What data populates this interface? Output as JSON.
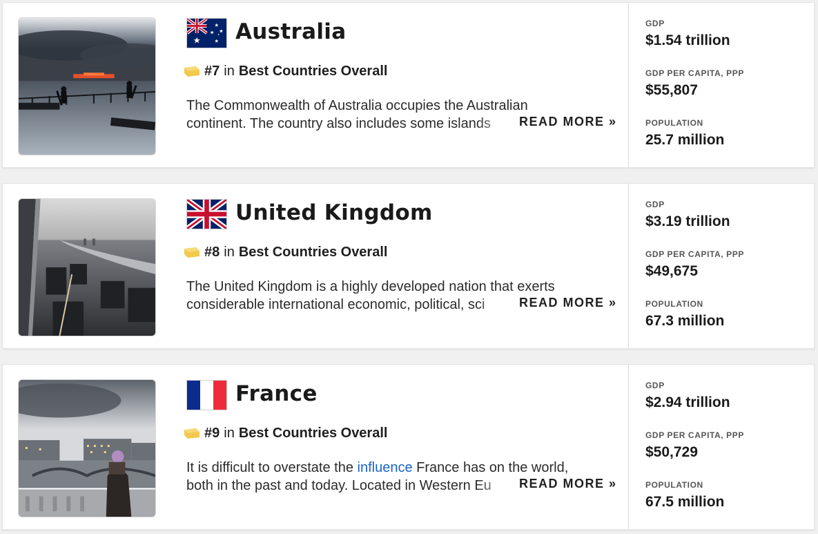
{
  "ranking_category": "Best Countries Overall",
  "rank_in": "in",
  "read_more": "READ MORE »",
  "stat_labels": {
    "gdp": "GDP",
    "gdp_per_capita": "GDP PER CAPITA, PPP",
    "population": "POPULATION"
  },
  "colors": {
    "link": "#1a63c7",
    "rank_icon": "#f2c94c"
  },
  "countries": [
    {
      "name": "Australia",
      "flag_icon": "australia-flag-icon",
      "rank": "#7",
      "desc_line1": "The Commonwealth of Australia occupies the Australian",
      "desc_line2": "continent. The country also includes some islands",
      "gdp": "$1.54 trillion",
      "gdp_per_capita": "$55,807",
      "population": "25.7 million"
    },
    {
      "name": "United Kingdom",
      "flag_icon": "united-kingdom-flag-icon",
      "rank": "#8",
      "desc_line1": "The United Kingdom is a highly developed nation that exerts",
      "desc_line2": "considerable international economic, political, sci",
      "gdp": "$3.19 trillion",
      "gdp_per_capita": "$49,675",
      "population": "67.3 million"
    },
    {
      "name": "France",
      "flag_icon": "france-flag-icon",
      "rank": "#9",
      "desc_line1_before": "It is difficult to overstate the ",
      "desc_line1_link": "influence",
      "desc_line1_after": " France has on the world,",
      "desc_line2": "both in the past and today. Located in Western Eu",
      "gdp": "$2.94 trillion",
      "gdp_per_capita": "$50,729",
      "population": "67.5 million"
    }
  ]
}
